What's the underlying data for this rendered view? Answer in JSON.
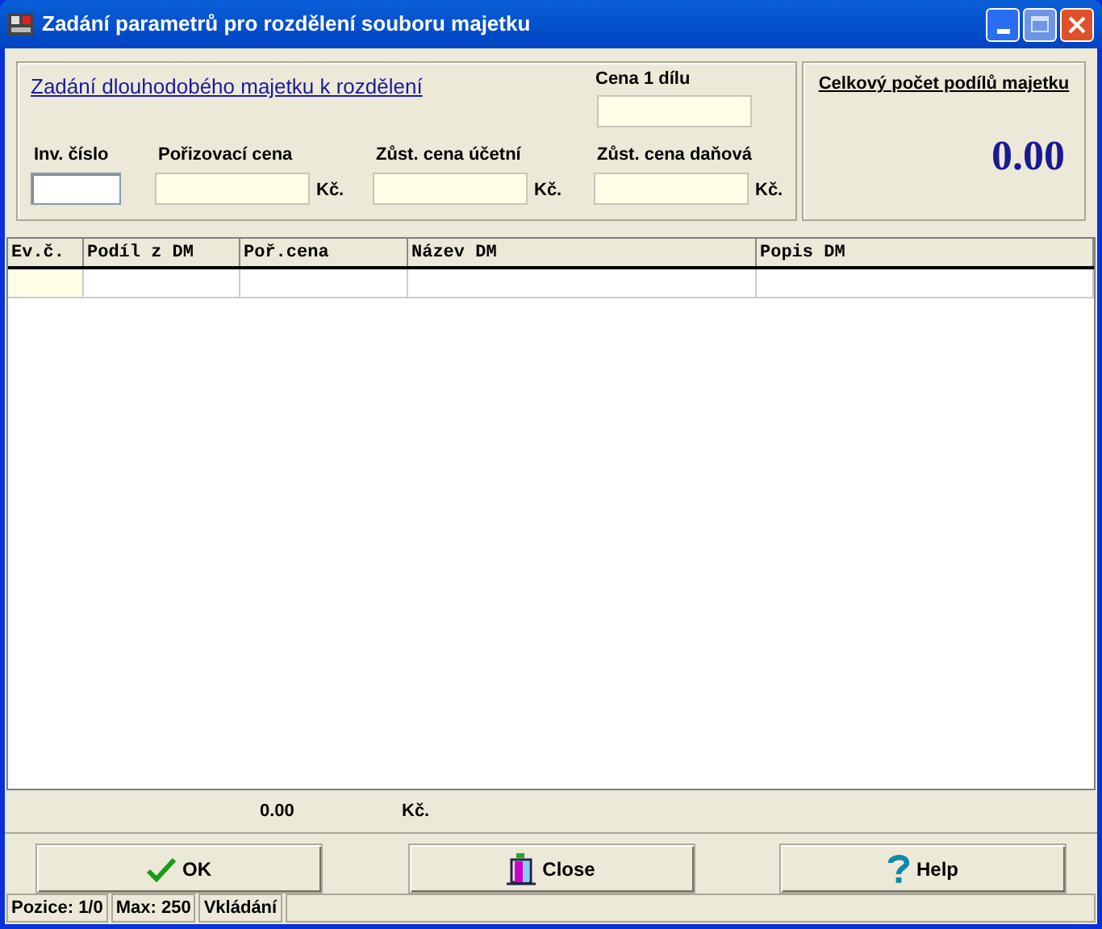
{
  "window": {
    "title": "Zadání parametrů pro rozdělení souboru majetku"
  },
  "form": {
    "heading": "Zadání dlouhodobého majetku k rozdělení",
    "price_part": {
      "label": "Cena 1 dílu"
    },
    "fields": [
      {
        "label": "Inv. číslo",
        "focused": true
      },
      {
        "label": "Pořizovací cena",
        "unit": "Kč.",
        "focused": false
      },
      {
        "label": "Zůst. cena účetní",
        "unit": "Kč.",
        "focused": false
      },
      {
        "label": "Zůst. cena daňová",
        "unit": "Kč.",
        "focused": false
      }
    ]
  },
  "total_panel": {
    "title": "Celkový počet podílů majetku",
    "value": "0.00"
  },
  "table": {
    "columns": [
      "Ev.č.",
      "Podíl z DM",
      "Poř.cena",
      "Název DM",
      "Popis DM"
    ]
  },
  "totals": {
    "sum": "0.00",
    "unit": "Kč."
  },
  "buttons": [
    {
      "label": "OK",
      "kind": "ok"
    },
    {
      "label": "Close",
      "kind": "close"
    },
    {
      "label": "Help",
      "kind": "help"
    }
  ],
  "status_bar": [
    "Pozice: 1/0",
    "Max: 250",
    "Vkládání"
  ]
}
